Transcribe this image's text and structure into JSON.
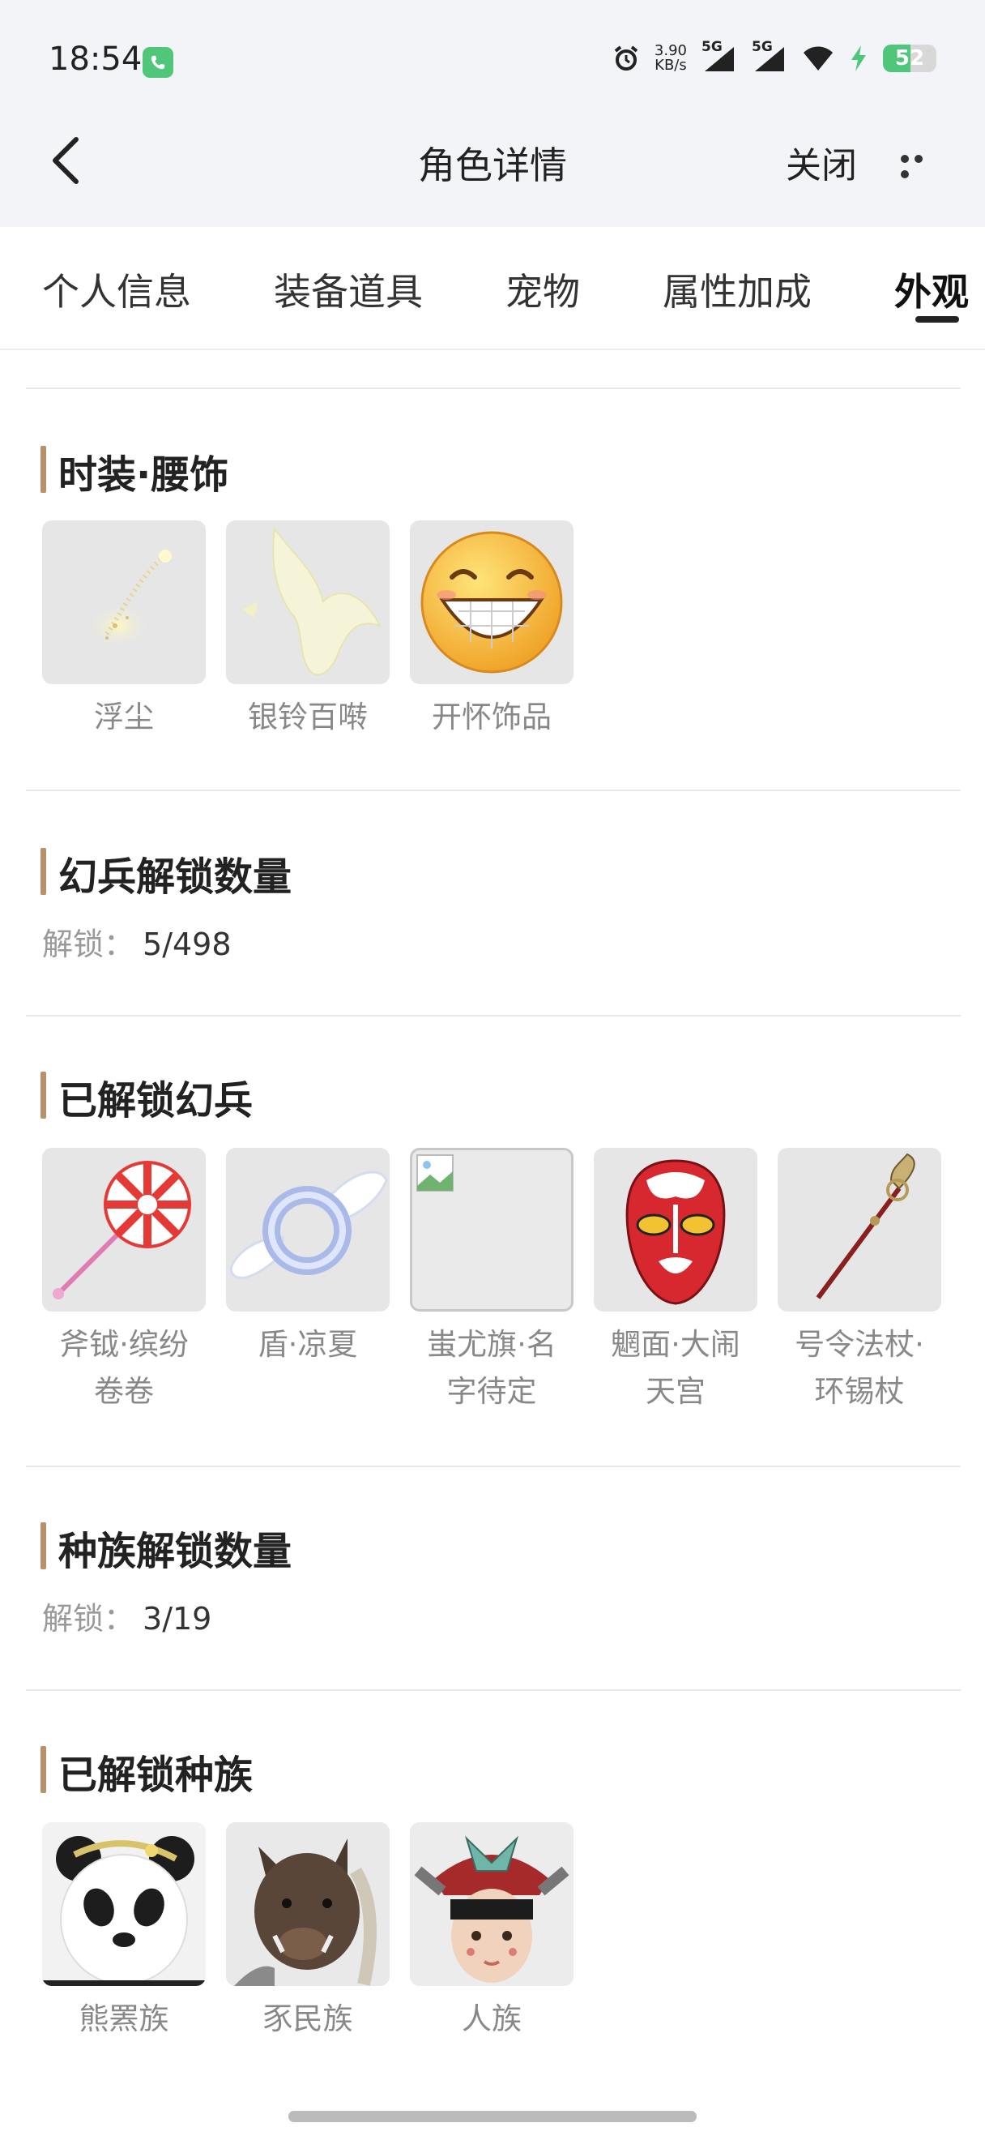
{
  "status_bar": {
    "time": "18:54",
    "net_speed_value": "3.90",
    "net_speed_unit": "KB/s",
    "network_1": "5G",
    "network_2": "5G",
    "battery": "52",
    "battery_level": 0.52,
    "accent_green": "#4fc67a"
  },
  "nav": {
    "title": "角色详情",
    "close_label": "关闭",
    "back_icon": "chevron-left-icon",
    "more_icon": "more-icon"
  },
  "tabs": [
    {
      "label": "个人信息",
      "active": false
    },
    {
      "label": "装备道具",
      "active": false
    },
    {
      "label": "宠物",
      "active": false
    },
    {
      "label": "属性加成",
      "active": false
    },
    {
      "label": "外观",
      "active": true
    }
  ],
  "sections": {
    "waist": {
      "title": "时装·腰饰",
      "items": [
        {
          "label": "浮尘",
          "icon": "sparkle-dust-icon"
        },
        {
          "label": "银铃百啭",
          "icon": "white-bird-icon"
        },
        {
          "label": "开怀饰品",
          "icon": "laughing-emoji-icon"
        }
      ]
    },
    "weapon_count": {
      "title": "幻兵解锁数量",
      "label": "解锁：",
      "value": "5/498"
    },
    "weapons": {
      "title": "已解锁幻兵",
      "items": [
        {
          "label_line1": "斧钺·缤纷",
          "label_line2": "卷卷",
          "icon": "lollipop-icon"
        },
        {
          "label_line1": "盾·凉夏",
          "label_line2": "",
          "icon": "winged-ring-icon"
        },
        {
          "label_line1": "蚩尤旗·名",
          "label_line2": "字待定",
          "icon": "broken-image-icon"
        },
        {
          "label_line1": "魍面·大闹",
          "label_line2": "天宫",
          "icon": "opera-mask-icon"
        },
        {
          "label_line1": "号令法杖·",
          "label_line2": "环锡杖",
          "icon": "staff-icon"
        }
      ]
    },
    "race_count": {
      "title": "种族解锁数量",
      "label": "解锁：",
      "value": "3/19"
    },
    "races": {
      "title": "已解锁种族",
      "items": [
        {
          "label": "熊罴族",
          "icon": "panda-portrait-icon"
        },
        {
          "label": "豕民族",
          "icon": "boar-portrait-icon"
        },
        {
          "label": "人族",
          "icon": "human-portrait-icon"
        }
      ]
    }
  },
  "colors": {
    "section_marker": "#b8906a",
    "header_bg": "#f3f4f8"
  }
}
